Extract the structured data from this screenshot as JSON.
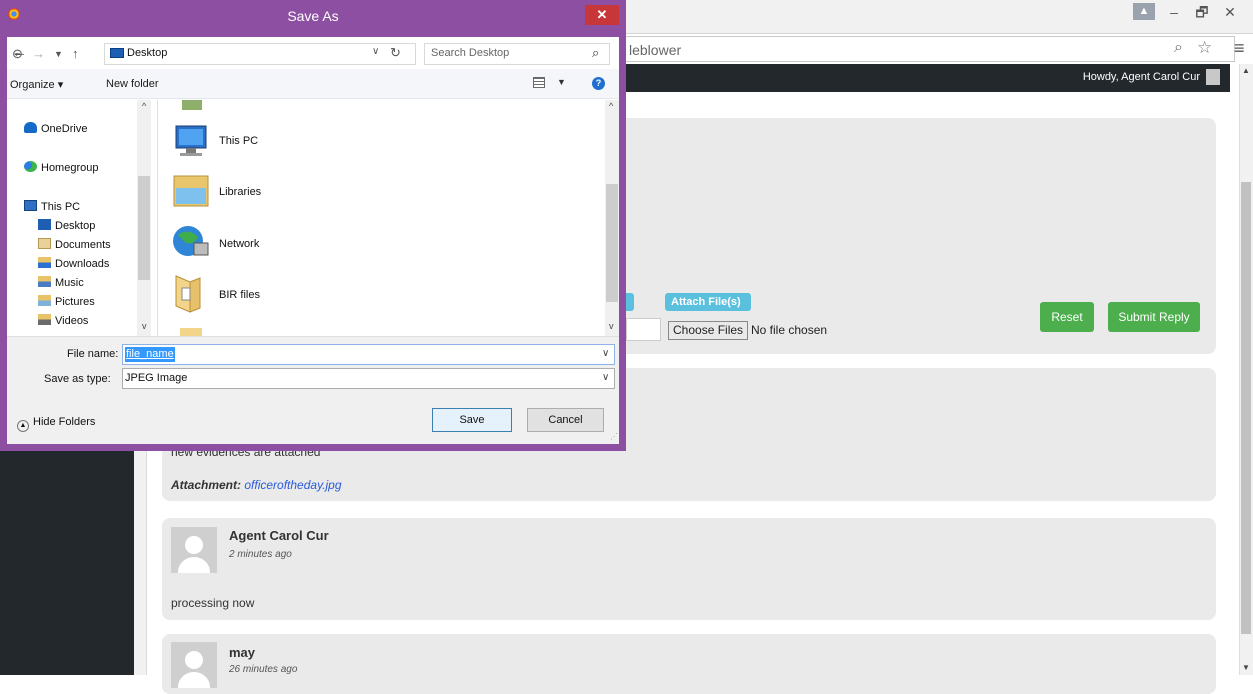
{
  "browser": {
    "address_text": "leblower",
    "profile_icon": "person-icon",
    "controls": {
      "minimize": "–",
      "restore": "🗗",
      "close": "✕"
    }
  },
  "adminbar": {
    "howdy": "Howdy, Agent Carol Cur"
  },
  "reply_form": {
    "attach_label": "Attach File(s)",
    "choose_files": "Choose Files",
    "no_file": "No file chosen",
    "reset": "Reset",
    "submit": "Submit Reply"
  },
  "messages": [
    {
      "text": "new evidences are attached",
      "attachment_label": "Attachment:",
      "attachment_file": "officeroftheday.jpg"
    },
    {
      "author": "Agent Carol Cur",
      "time": "2 minutes ago",
      "text": "processing now"
    },
    {
      "author": "may",
      "time": "26 minutes ago"
    }
  ],
  "dialog": {
    "title": "Save As",
    "path": "Desktop",
    "search_placeholder": "Search Desktop",
    "organize": "Organize ▾",
    "new_folder": "New folder",
    "nav_tree": [
      {
        "label": "OneDrive",
        "icon": "cloud-icon"
      },
      {
        "label": "Homegroup",
        "icon": "homegroup-icon"
      },
      {
        "label": "This PC",
        "icon": "computer-icon"
      },
      {
        "label": "Desktop",
        "icon": "desktop-icon"
      },
      {
        "label": "Documents",
        "icon": "documents-icon"
      },
      {
        "label": "Downloads",
        "icon": "downloads-icon"
      },
      {
        "label": "Music",
        "icon": "music-icon"
      },
      {
        "label": "Pictures",
        "icon": "pictures-icon"
      },
      {
        "label": "Videos",
        "icon": "videos-icon"
      }
    ],
    "files": [
      {
        "label": "This PC",
        "icon": "computer-icon"
      },
      {
        "label": "Libraries",
        "icon": "libraries-icon"
      },
      {
        "label": "Network",
        "icon": "network-icon"
      },
      {
        "label": "BIR files",
        "icon": "folder-icon"
      }
    ],
    "file_name_label": "File name:",
    "file_name_value": "file_name",
    "save_type_label": "Save as type:",
    "save_type_value": "JPEG Image",
    "hide_folders": "Hide Folders",
    "save": "Save",
    "cancel": "Cancel"
  },
  "colors": {
    "dialog_frame": "#8c4fa1",
    "close_button": "#c7373a",
    "admin_bar": "#23282d",
    "green_button": "#4cae4c",
    "attach_blue": "#5bc0de"
  }
}
